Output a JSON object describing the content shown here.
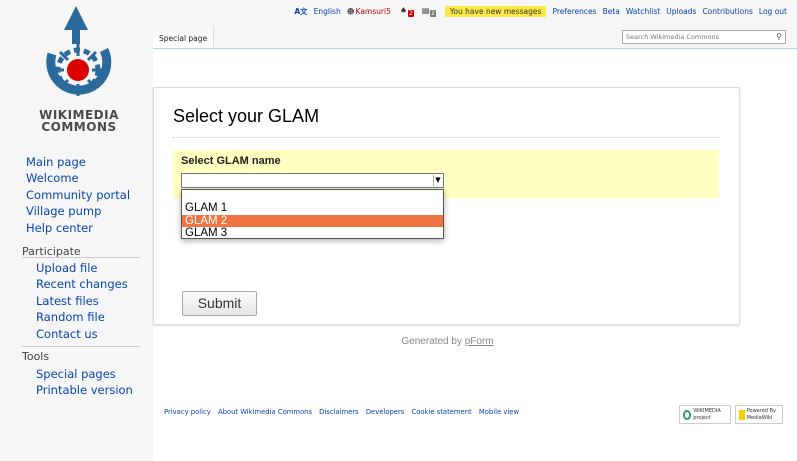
{
  "logo": {
    "line1": "WIKIMEDIA",
    "line2": "COMMONS"
  },
  "sidebar": {
    "nav": [
      "Main page",
      "Welcome",
      "Community portal",
      "Village pump",
      "Help center"
    ],
    "participate": {
      "heading": "Participate",
      "items": [
        "Upload file",
        "Recent changes",
        "Latest files",
        "Random file",
        "Contact us"
      ]
    },
    "tools": {
      "heading": "Tools",
      "items": [
        "Special pages",
        "Printable version"
      ]
    }
  },
  "personal": {
    "language": "English",
    "username": "Kamsuri5",
    "alerts_count": "2",
    "notices_count": "2",
    "messages": "You have new messages",
    "links": [
      "Preferences",
      "Beta",
      "Watchlist",
      "Uploads",
      "Contributions",
      "Log out"
    ]
  },
  "tabs": {
    "special": "Special page"
  },
  "search": {
    "placeholder": "Search Wikimedia Commons"
  },
  "form": {
    "title": "Select your GLAM",
    "field_label": "Select GLAM name",
    "selected_value": "",
    "options": [
      "GLAM 1",
      "GLAM 2",
      "GLAM 3"
    ],
    "highlighted_option": "GLAM 2",
    "submit_label": "Submit",
    "generated_prefix": "Generated by ",
    "generated_link": "pForm"
  },
  "footer": {
    "links": [
      "Privacy policy",
      "About Wikimedia Commons",
      "Disclaimers",
      "Developers",
      "Cookie statement",
      "Mobile view"
    ],
    "badge_wikimedia": "WIKIMEDIA project",
    "badge_mediawiki": "Powered By MediaWiki"
  },
  "colors": {
    "link": "#0645ad",
    "highlight": "#ee7443",
    "field_bg": "#ffffbf",
    "message_bg": "#fce943"
  }
}
